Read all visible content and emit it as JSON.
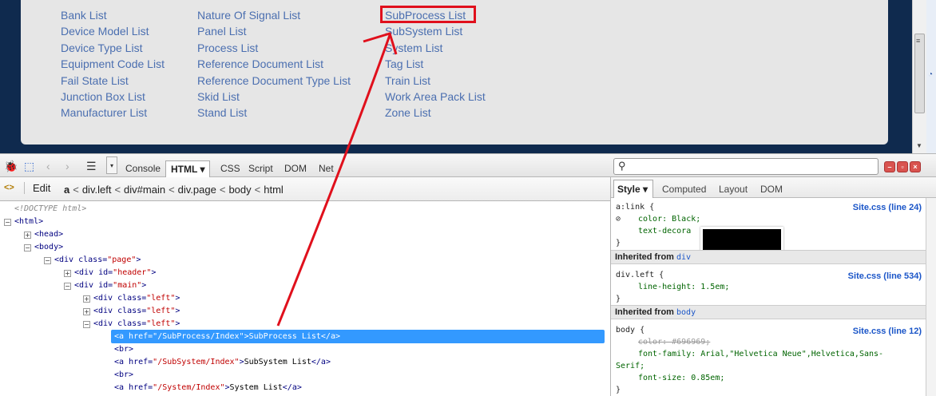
{
  "webpage": {
    "col1": [
      "Bank List",
      "Device Model List",
      "Device Type List",
      "Equipment Code List",
      "Fail State List",
      "Junction Box List",
      "Manufacturer List"
    ],
    "col2": [
      "Nature Of Signal List",
      "Panel List",
      "Process List",
      "Reference Document List",
      "Reference Document Type List",
      "Skid List",
      "Stand List"
    ],
    "col3": [
      "SubProcess List",
      "SubSystem List",
      "System List",
      "Tag List",
      "Train List",
      "Work Area Pack List",
      "Zone List"
    ],
    "highlighted_link": "SubProcess List",
    "annotation_color": "#e0101c"
  },
  "toolbar": {
    "tabs": [
      "Console",
      "HTML",
      "CSS",
      "Script",
      "DOM",
      "Net"
    ],
    "active_tab": "HTML",
    "active_tab_arrow": "▾",
    "search_placeholder": ""
  },
  "breadcrumb": {
    "edit_label": "Edit",
    "items": [
      "a",
      "div.left",
      "div#main",
      "div.page",
      "body",
      "html"
    ]
  },
  "tree": {
    "doctype": "<!DOCTYPE html>",
    "selected_href": "/SubProcess/Index",
    "selected_text": "SubProcess List",
    "next1_href": "/SubSystem/Index",
    "next1_text": "SubSystem List",
    "next2_href": "/System/Index",
    "next2_text": "System List"
  },
  "side": {
    "tabs": [
      "Style",
      "Computed",
      "Layout",
      "DOM"
    ],
    "active_tab": "Style",
    "rule1": {
      "selector": "a:link {",
      "p1": "color: Black;",
      "p2": "text-decora",
      "close": "}",
      "source": "Site.css (line 24)"
    },
    "inherited1": {
      "label": "Inherited from",
      "element": "div"
    },
    "rule2": {
      "selector": "div.left {",
      "p1": "line-height: 1.5em;",
      "close": "}",
      "source": "Site.css (line 534)"
    },
    "inherited2": {
      "label": "Inherited from",
      "element": "body"
    },
    "rule3": {
      "selector": "body {",
      "p1": "color: #696969;",
      "p2": "font-family: Arial,\"Helvetica Neue\",Helvetica,Sans-",
      "p2b": "Serif;",
      "p3": "font-size: 0.85em;",
      "close": "}",
      "source": "Site.css (line 12)"
    }
  }
}
